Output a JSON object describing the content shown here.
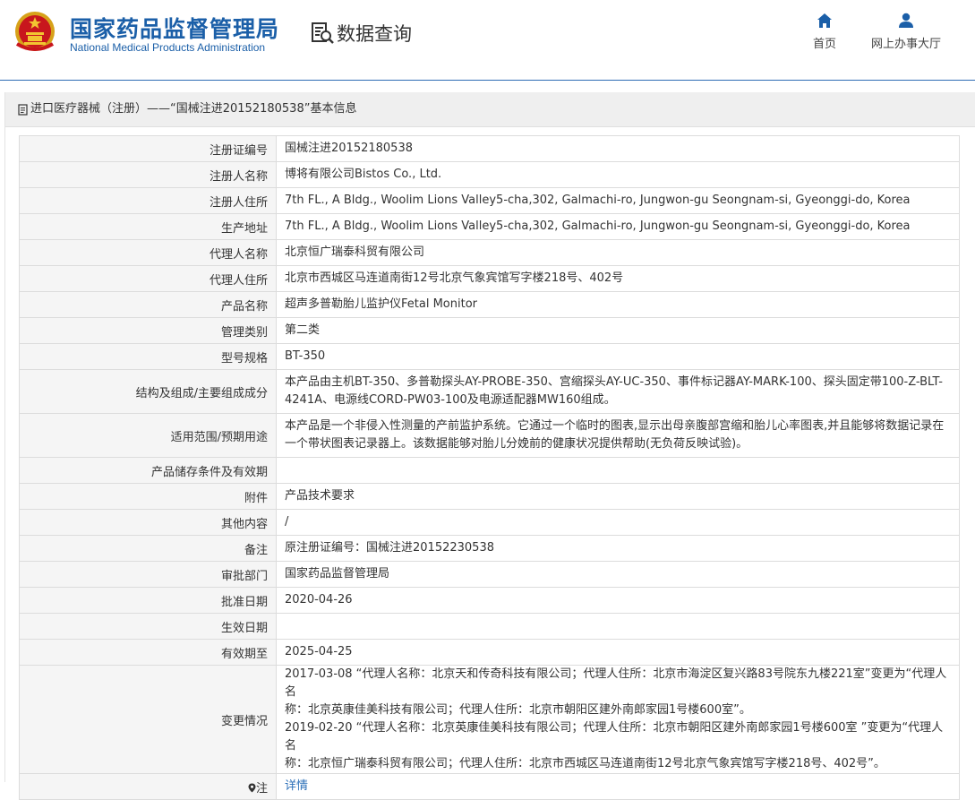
{
  "header": {
    "site_name_cn": "国家药品监督管理局",
    "site_name_en": "National Medical Products Administration",
    "query_label": "数据查询",
    "nav": [
      {
        "label": "首页",
        "icon": "home-icon"
      },
      {
        "label": "网上办事大厅",
        "icon": "user-icon"
      }
    ],
    "accent": "#1b5fa8"
  },
  "panel": {
    "title": "进口医疗器械（注册）——“国械注进20152180538”基本信息"
  },
  "rows": [
    {
      "label": "注册证编号",
      "value": "国械注进20152180538"
    },
    {
      "label": "注册人名称",
      "value": "博将有限公司Bistos Co., Ltd."
    },
    {
      "label": "注册人住所",
      "value": "7th FL., A Bldg., Woolim Lions Valley5-cha,302, Galmachi-ro, Jungwon-gu Seongnam-si, Gyeonggi-do, Korea"
    },
    {
      "label": "生产地址",
      "value": "7th FL., A Bldg., Woolim Lions Valley5-cha,302, Galmachi-ro, Jungwon-gu Seongnam-si, Gyeonggi-do, Korea"
    },
    {
      "label": "代理人名称",
      "value": "北京恒广瑞泰科贸有限公司"
    },
    {
      "label": "代理人住所",
      "value": "北京市西城区马连道南街12号北京气象宾馆写字楼218号、402号"
    },
    {
      "label": "产品名称",
      "value": "超声多普勒胎儿监护仪Fetal Monitor"
    },
    {
      "label": "管理类别",
      "value": "第二类"
    },
    {
      "label": "型号规格",
      "value": "BT-350"
    },
    {
      "label": "结构及组成/主要组成成分",
      "value": "本产品由主机BT-350、多普勒探头AY-PROBE-350、宫缩探头AY-UC-350、事件标记器AY-MARK-100、探头固定带100-Z-BLT-4241A、电源线CORD-PW03-100及电源适配器MW160组成。"
    },
    {
      "label": "适用范围/预期用途",
      "value": "本产品是一个非侵入性测量的产前监护系统。它通过一个临时的图表,显示出母亲腹部宫缩和胎儿心率图表,并且能够将数据记录在一个带状图表记录器上。该数据能够对胎儿分娩前的健康状况提供帮助(无负荷反映试验)。"
    },
    {
      "label": "产品储存条件及有效期",
      "value": ""
    },
    {
      "label": "附件",
      "value": "产品技术要求"
    },
    {
      "label": "其他内容",
      "value": "/"
    },
    {
      "label": "备注",
      "value": "原注册证编号：国械注进20152230538"
    },
    {
      "label": "审批部门",
      "value": "国家药品监督管理局"
    },
    {
      "label": "批准日期",
      "value": "2020-04-26"
    },
    {
      "label": "生效日期",
      "value": ""
    },
    {
      "label": "有效期至",
      "value": "2025-04-25"
    }
  ],
  "change": {
    "label": "变更情况",
    "lines": [
      "2017-03-08 “代理人名称：北京天和传奇科技有限公司；代理人住所：北京市海淀区复兴路83号院东九楼221室”变更为“代理人名",
      "称：北京英康佳美科技有限公司；代理人住所：北京市朝阳区建外南郎家园1号楼600室”。",
      "2019-02-20 “代理人名称：北京英康佳美科技有限公司；代理人住所：北京市朝阳区建外南郎家园1号楼600室 ”变更为“代理人名",
      "称：北京恒广瑞泰科贸有限公司；代理人住所：北京市西城区马连道南街12号北京气象宾馆写字楼218号、402号”。"
    ]
  },
  "note": {
    "label": "注",
    "icon": "pin-icon",
    "link": "详情"
  }
}
